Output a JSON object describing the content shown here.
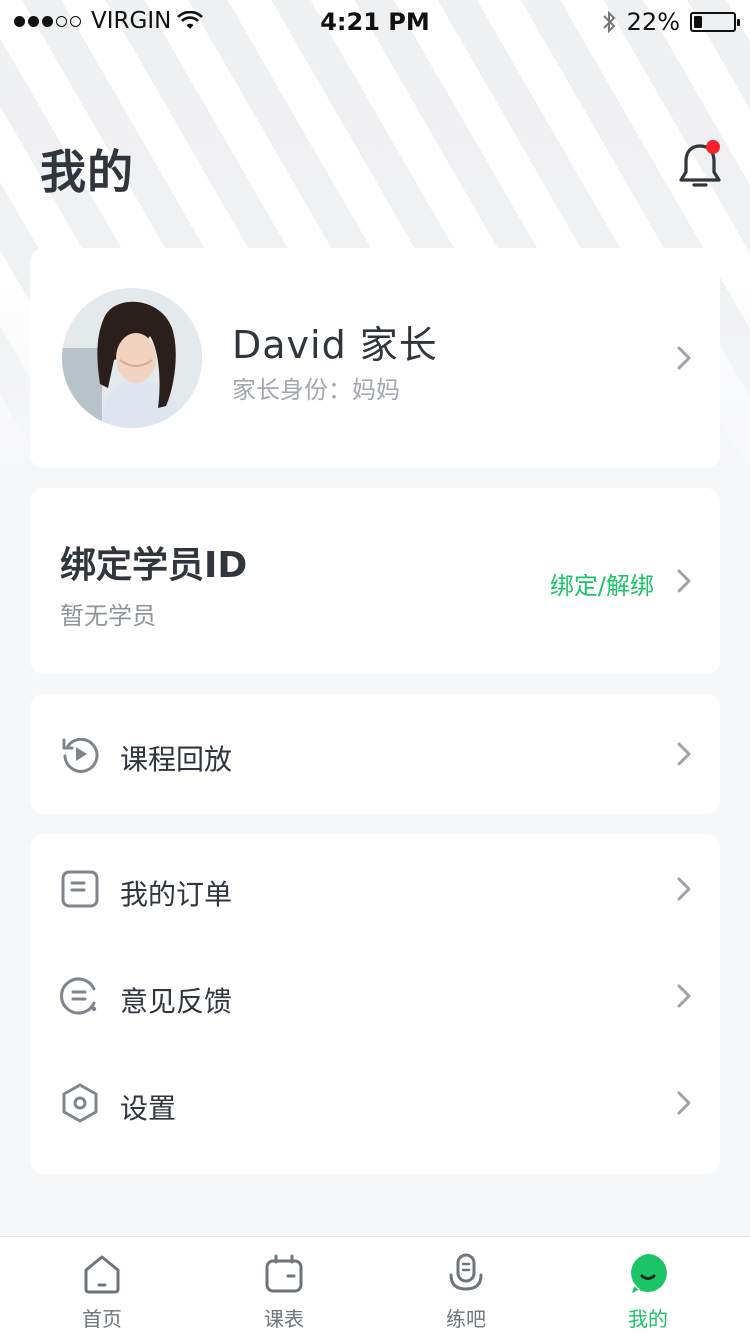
{
  "status_bar": {
    "carrier": "VIRGIN",
    "time": "4:21 PM",
    "battery": "22%",
    "battery_level": 0.22,
    "signal_bars_filled": 3,
    "signal_bars_total": 5
  },
  "header": {
    "title": "我的",
    "notification_badge": true
  },
  "profile": {
    "name": "David 家长",
    "role": "家长身份：妈妈"
  },
  "bind_student": {
    "title": "绑定学员ID",
    "subtitle": "暂无学员",
    "action": "绑定/解绑"
  },
  "replay": {
    "label": "课程回放",
    "icon": "replay-icon"
  },
  "menu": [
    {
      "label": "我的订单",
      "icon": "order-icon"
    },
    {
      "label": "意见反馈",
      "icon": "feedback-icon"
    },
    {
      "label": "设置",
      "icon": "settings-icon"
    }
  ],
  "tabbar": [
    {
      "label": "首页",
      "icon": "home-icon",
      "active": false
    },
    {
      "label": "课表",
      "icon": "schedule-icon",
      "active": false
    },
    {
      "label": "练吧",
      "icon": "microphone-icon",
      "active": false
    },
    {
      "label": "我的",
      "icon": "profile-face-icon",
      "active": true
    }
  ],
  "colors": {
    "accent": "#1bc467",
    "badge": "#f5222d",
    "text_primary": "#30363d",
    "text_secondary": "#a4a8ad",
    "icon_gray": "#7f858a"
  }
}
